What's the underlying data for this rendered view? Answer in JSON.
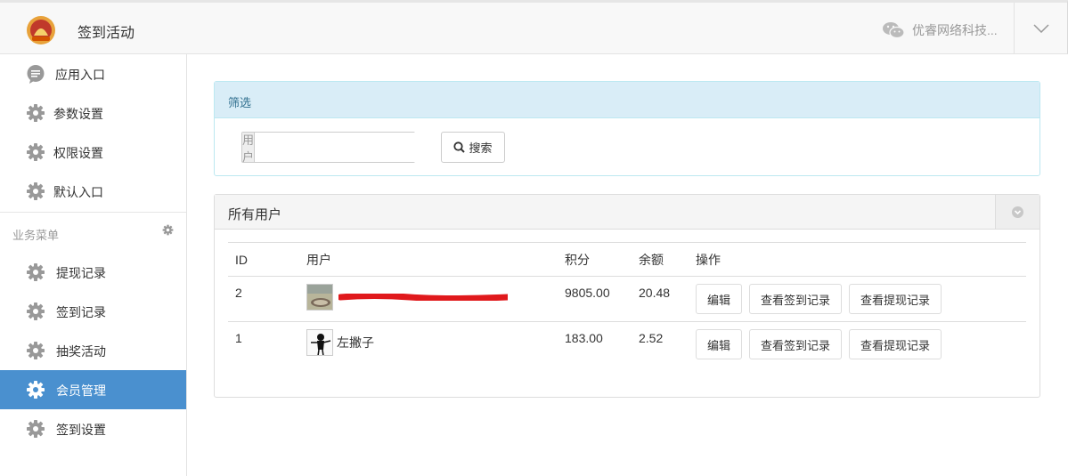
{
  "header": {
    "app_title": "签到活动",
    "account_name": "优睿网络科技...",
    "logo_icon": "app-logo",
    "account_icon": "wechat-icon",
    "dropdown_icon": "chevron-down-icon"
  },
  "sidebar": {
    "items": [
      {
        "label": "应用入口",
        "icon": "chat-bubble-icon"
      },
      {
        "label": "参数设置",
        "icon": "gear-icon"
      },
      {
        "label": "权限设置",
        "icon": "gear-icon"
      },
      {
        "label": "默认入口",
        "icon": "gear-icon"
      }
    ],
    "group_title": "业务菜单",
    "group_items": [
      {
        "label": "提现记录",
        "icon": "gear-icon"
      },
      {
        "label": "签到记录",
        "icon": "gear-icon"
      },
      {
        "label": "抽奖活动",
        "icon": "gear-icon"
      },
      {
        "label": "会员管理",
        "icon": "gear-icon",
        "active": true
      },
      {
        "label": "签到设置",
        "icon": "gear-icon"
      }
    ],
    "active_color": "#4a90cf"
  },
  "filter": {
    "title": "筛选",
    "user_label": "用户",
    "user_value": "",
    "search_label": "搜索"
  },
  "users": {
    "title": "所有用户",
    "columns": [
      "ID",
      "用户",
      "积分",
      "余额",
      "操作"
    ],
    "rows": [
      {
        "id": "2",
        "name": "",
        "name_redacted": true,
        "points": "9805.00",
        "balance": "20.48"
      },
      {
        "id": "1",
        "name": "左撇子",
        "name_redacted": false,
        "points": "183.00",
        "balance": "2.52"
      }
    ],
    "actions": {
      "edit": "编辑",
      "view_checkins": "查看签到记录",
      "view_withdrawals": "查看提现记录"
    }
  }
}
